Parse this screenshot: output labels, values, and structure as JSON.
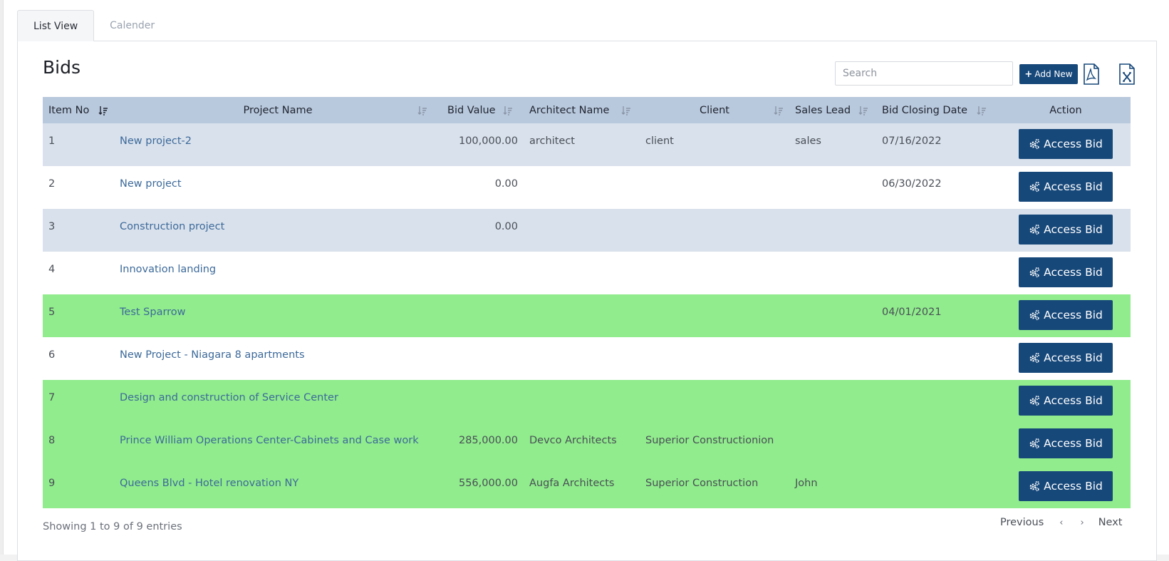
{
  "tabs": [
    {
      "label": "List View",
      "active": true
    },
    {
      "label": "Calender",
      "active": false
    }
  ],
  "page_title": "Bids",
  "search": {
    "placeholder": "Search",
    "value": ""
  },
  "toolbar": {
    "add_label": "Add New",
    "pdf_icon": "pdf-file-icon",
    "excel_icon": "excel-file-icon"
  },
  "colors": {
    "primary": "#17487a",
    "header_bg": "#b9c9dd",
    "row_blue": "#d9e1ec",
    "row_green": "#90ec8c",
    "link": "#3d6a9a"
  },
  "table": {
    "columns": [
      "Item No",
      "Project Name",
      "Bid Value",
      "Architect Name",
      "Client",
      "Sales Lead",
      "Bid Closing Date",
      "Action"
    ],
    "rows": [
      {
        "no": "1",
        "project": "New project-2",
        "value": "100,000.00",
        "architect": "architect",
        "client": "client",
        "sales": "sales",
        "closing": "07/16/2022",
        "action": "Access Bid",
        "style": "blue"
      },
      {
        "no": "2",
        "project": "New project",
        "value": "0.00",
        "architect": "",
        "client": "",
        "sales": "",
        "closing": "06/30/2022",
        "action": "Access Bid",
        "style": "white"
      },
      {
        "no": "3",
        "project": "Construction project",
        "value": "0.00",
        "architect": "",
        "client": "",
        "sales": "",
        "closing": "",
        "action": "Access Bid",
        "style": "blue"
      },
      {
        "no": "4",
        "project": "Innovation landing",
        "value": "",
        "architect": "",
        "client": "",
        "sales": "",
        "closing": "",
        "action": "Access Bid",
        "style": "white"
      },
      {
        "no": "5",
        "project": "Test Sparrow",
        "value": "",
        "architect": "",
        "client": "",
        "sales": "",
        "closing": "04/01/2021",
        "action": "Access Bid",
        "style": "green"
      },
      {
        "no": "6",
        "project": "New Project - Niagara 8 apartments",
        "value": "",
        "architect": "",
        "client": "",
        "sales": "",
        "closing": "",
        "action": "Access Bid",
        "style": "white"
      },
      {
        "no": "7",
        "project": "Design and construction of Service Center",
        "value": "",
        "architect": "",
        "client": "",
        "sales": "",
        "closing": "",
        "action": "Access Bid",
        "style": "green"
      },
      {
        "no": "8",
        "project": "Prince William Operations Center-Cabinets and Case work",
        "value": "285,000.00",
        "architect": "Devco Architects",
        "client": "Superior Constructionion",
        "sales": "",
        "closing": "",
        "action": "Access Bid",
        "style": "green"
      },
      {
        "no": "9",
        "project": "Queens Blvd - Hotel renovation NY",
        "value": "556,000.00",
        "architect": "Augfa Architects",
        "client": "Superior Construction",
        "sales": "John",
        "closing": "",
        "action": "Access Bid",
        "style": "green"
      }
    ]
  },
  "footer": {
    "info": "Showing 1 to 9 of 9 entries",
    "previous": "Previous",
    "next": "Next",
    "prev_icon": "chevron-left-icon",
    "next_icon": "chevron-right-icon"
  }
}
